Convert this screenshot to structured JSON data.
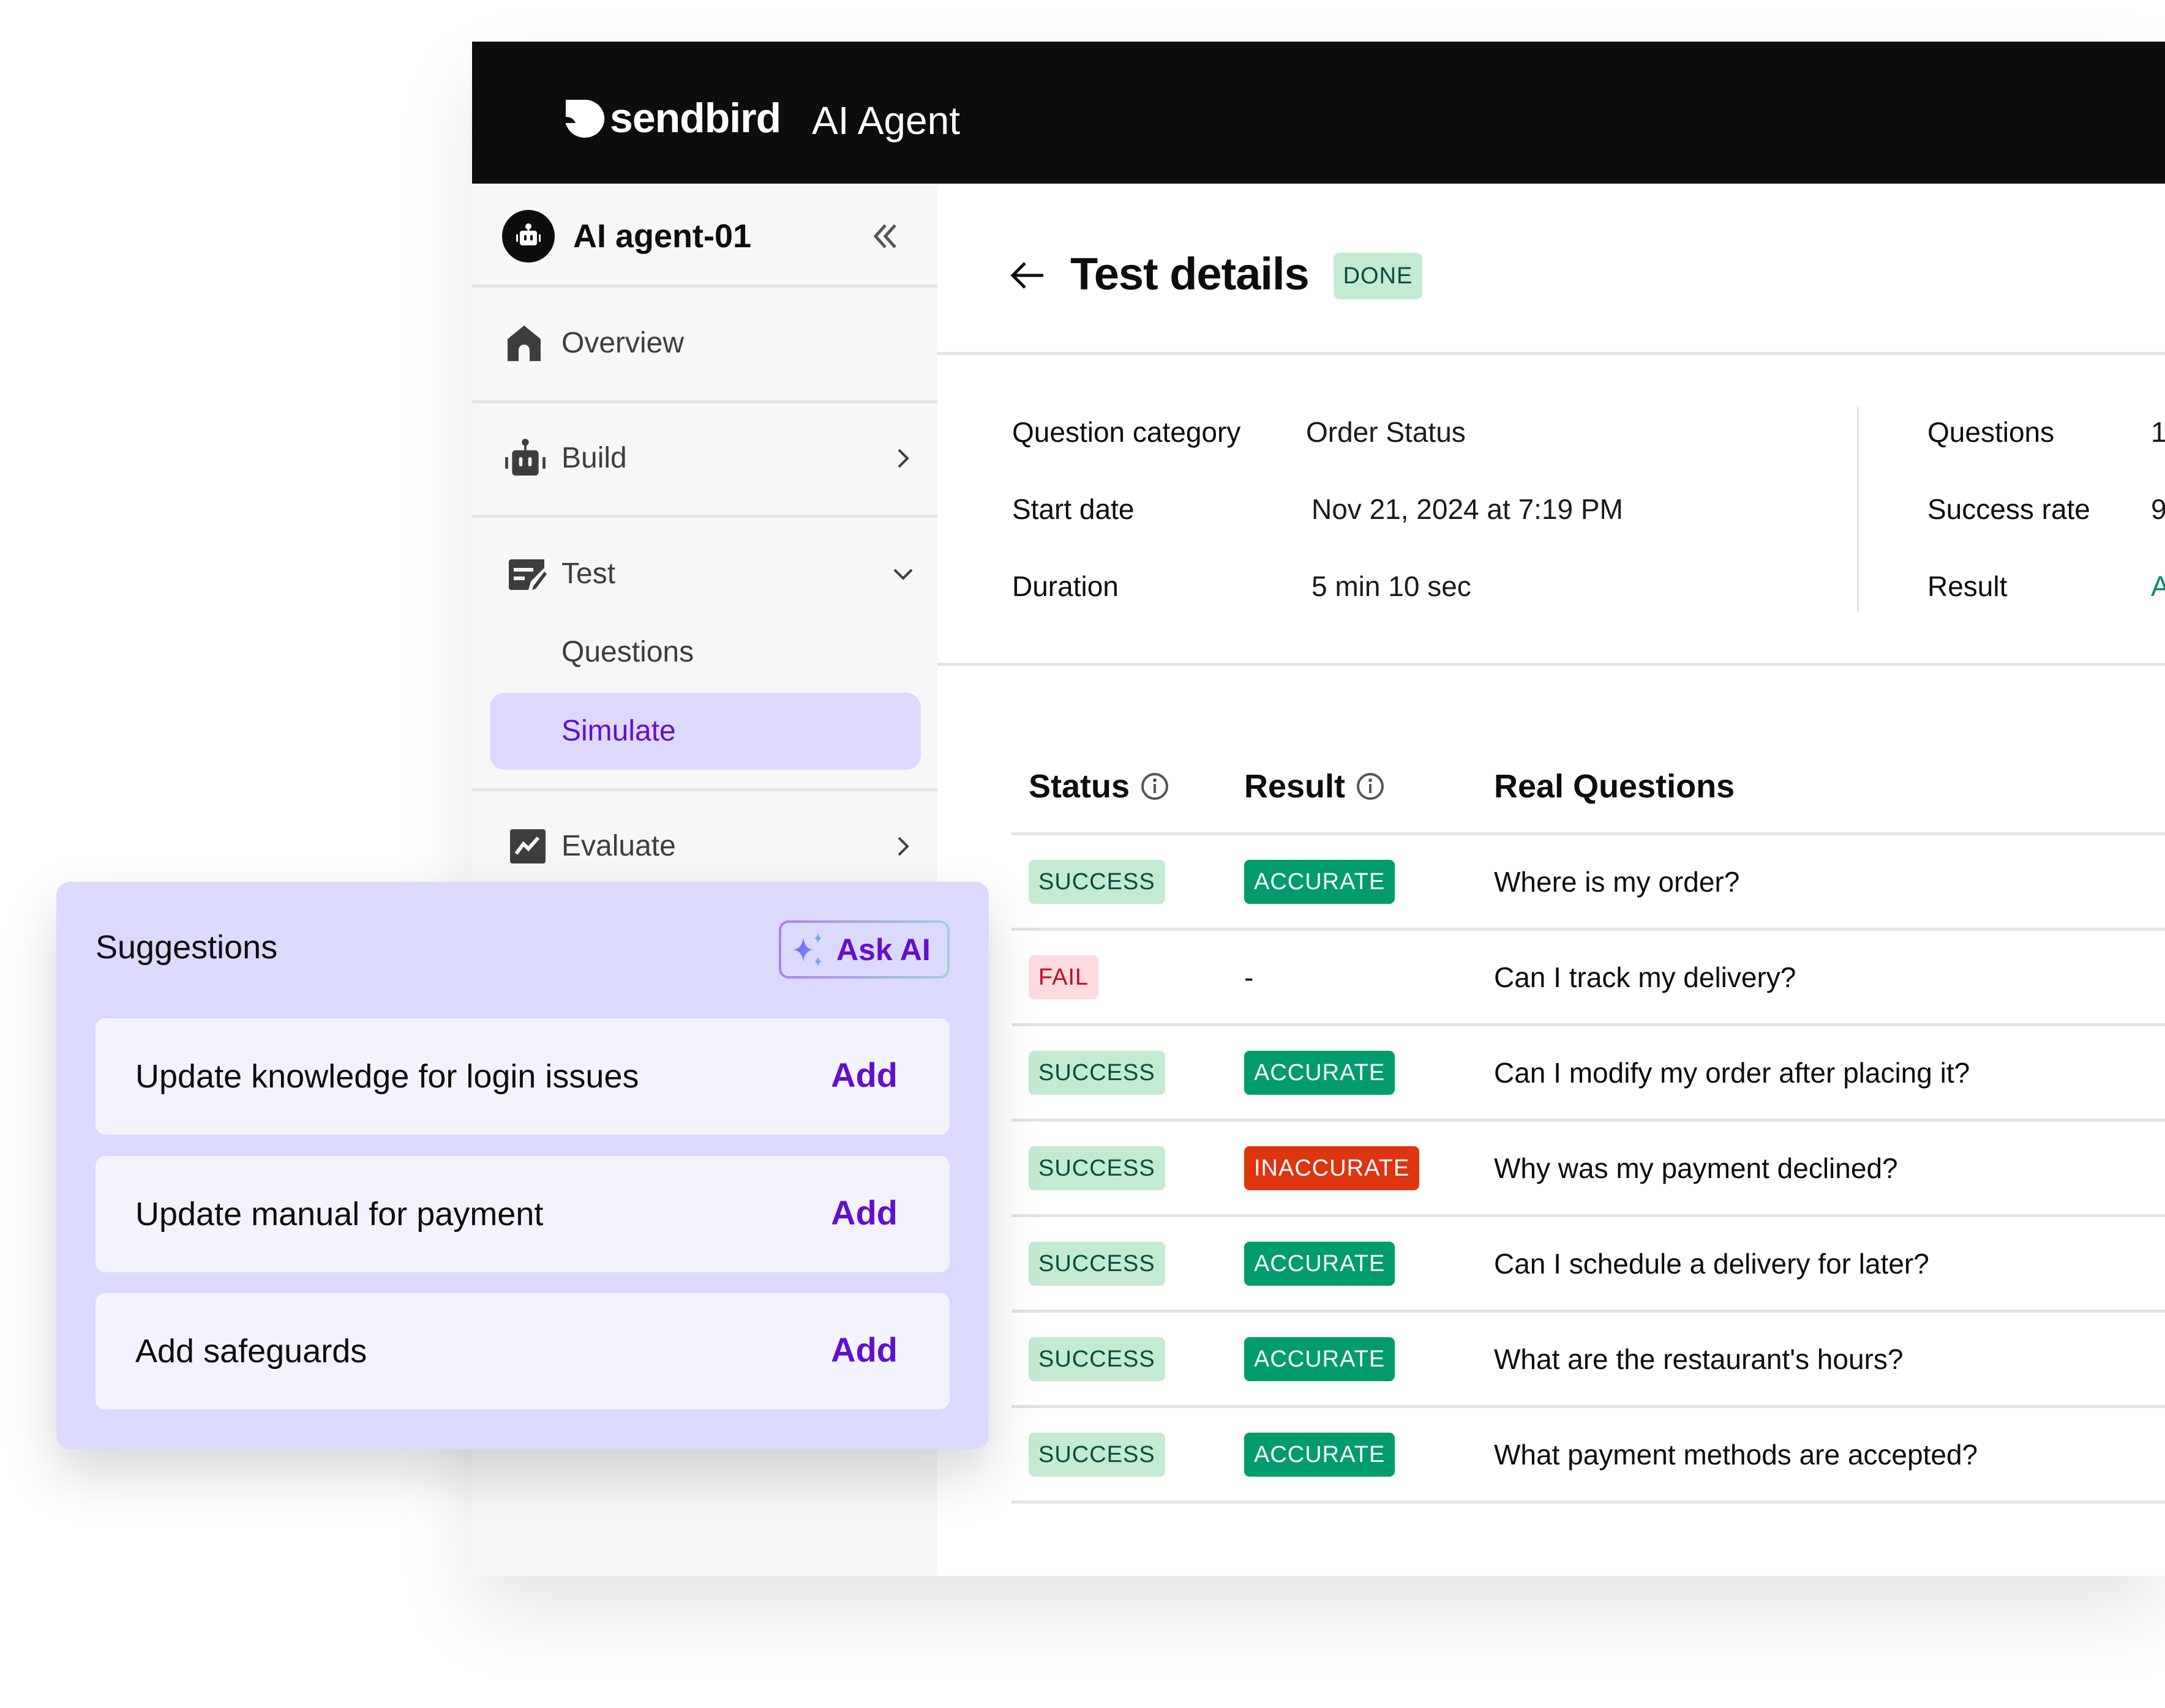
{
  "header": {
    "brand": "sendbird",
    "product": "AI Agent"
  },
  "sidebar": {
    "agent_name": "AI agent-01",
    "items": [
      {
        "label": "Overview",
        "icon": "home-icon"
      },
      {
        "label": "Build",
        "icon": "robot-icon",
        "chevron": "chevron-right-icon"
      },
      {
        "label": "Test",
        "icon": "test-edit-icon",
        "chevron": "chevron-down-icon",
        "expanded": true,
        "children": [
          {
            "label": "Questions",
            "active": false
          },
          {
            "label": "Simulate",
            "active": true
          }
        ]
      },
      {
        "label": "Evaluate",
        "icon": "chart-trend-icon",
        "chevron": "chevron-right-icon"
      }
    ]
  },
  "page": {
    "title": "Test details",
    "status_badge": "DONE"
  },
  "info": {
    "left": [
      {
        "label": "Question category",
        "value": "Order Status"
      },
      {
        "label": "Start date",
        "value": "Nov 21, 2024 at 7:19 PM"
      },
      {
        "label": "Duration",
        "value": "5 min 10 sec"
      }
    ],
    "right": [
      {
        "label": "Questions",
        "value": "1"
      },
      {
        "label": "Success rate",
        "value": "9"
      },
      {
        "label": "Result",
        "value": "A"
      }
    ]
  },
  "table": {
    "columns": [
      "Status",
      "Result",
      "Real Questions"
    ],
    "rows": [
      {
        "status": "SUCCESS",
        "result": "ACCURATE",
        "question": "Where is my order?"
      },
      {
        "status": "FAIL",
        "result": "-",
        "question": "Can I track my delivery?"
      },
      {
        "status": "SUCCESS",
        "result": "ACCURATE",
        "question": "Can I modify my order after placing it?"
      },
      {
        "status": "SUCCESS",
        "result": "INACCURATE",
        "question": "Why was my payment declined?"
      },
      {
        "status": "SUCCESS",
        "result": "ACCURATE",
        "question": "Can I schedule a delivery for later?"
      },
      {
        "status": "SUCCESS",
        "result": "ACCURATE",
        "question": "What are the restaurant's hours?"
      },
      {
        "status": "SUCCESS",
        "result": "ACCURATE",
        "question": "What payment methods are accepted?"
      }
    ]
  },
  "suggestions": {
    "title": "Suggestions",
    "ask_ai_label": "Ask AI",
    "items": [
      {
        "text": "Update knowledge for login issues",
        "action": "Add"
      },
      {
        "text": "Update manual for payment",
        "action": "Add"
      },
      {
        "text": "Add safeguards",
        "action": "Add"
      }
    ]
  },
  "colors": {
    "accent_purple": "#6210cc",
    "selected_bg": "#dcd9fd",
    "success_bg": "#c4ead2",
    "accurate_bg": "#009c6c",
    "inaccurate_bg": "#dd3510",
    "fail_bg": "#fddbe0"
  }
}
